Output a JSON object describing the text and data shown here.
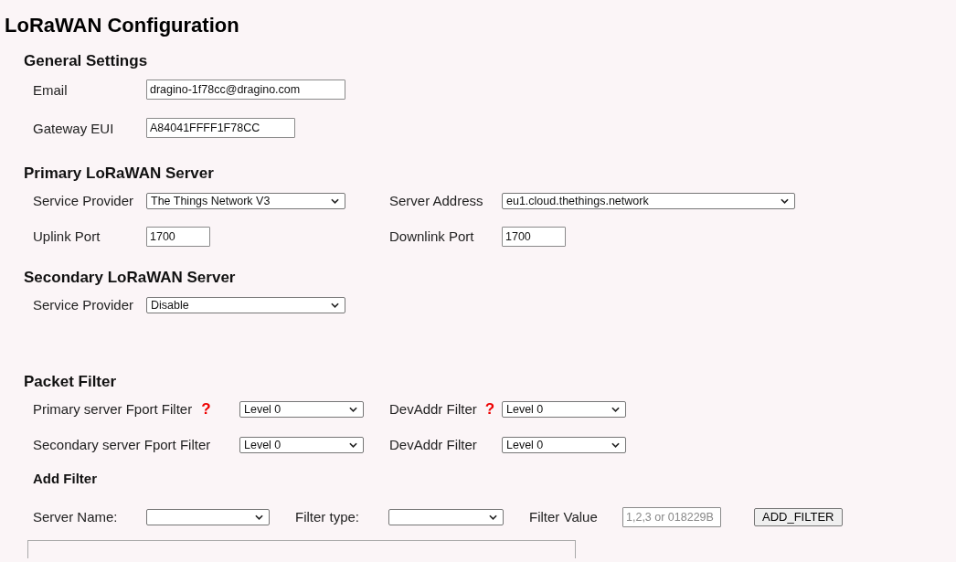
{
  "title": "LoRaWAN Configuration",
  "sections": [
    {
      "heading": "General Settings",
      "rows": [
        [
          {
            "label": "Email",
            "field": {
              "kind": "input",
              "value": "dragino-1f78cc@dragino.com"
            }
          }
        ],
        [
          {
            "label": "Gateway EUI",
            "field": {
              "kind": "input",
              "value": "A84041FFFF1F78CC"
            }
          }
        ]
      ]
    },
    {
      "heading": "Primary LoRaWAN Server",
      "rows": [
        [
          {
            "label": "Service Provider",
            "field": {
              "kind": "select",
              "value": "The Things Network V3"
            }
          },
          {
            "label": "Server Address",
            "field": {
              "kind": "select",
              "value": "eu1.cloud.thethings.network"
            }
          }
        ],
        [
          {
            "label": "Uplink Port",
            "field": {
              "kind": "input",
              "value": "1700"
            }
          },
          {
            "label": "Downlink Port",
            "field": {
              "kind": "input",
              "value": "1700"
            }
          }
        ]
      ]
    },
    {
      "heading": "Secondary LoRaWAN Server",
      "rows": [
        [
          {
            "label": "Service Provider",
            "field": {
              "kind": "select",
              "value": "Disable"
            }
          }
        ]
      ]
    },
    {
      "heading": "Packet Filter",
      "rows": [
        [
          {
            "label": "Primary server Fport Filter",
            "help": "?",
            "field": {
              "kind": "select",
              "value": "Level 0"
            }
          },
          {
            "label": "DevAddr Filter",
            "help": "?",
            "field": {
              "kind": "select",
              "value": "Level 0"
            }
          }
        ],
        [
          {
            "label": "Secondary server Fport Filter",
            "field": {
              "kind": "select",
              "value": "Level 0"
            }
          },
          {
            "label": "DevAddr Filter",
            "field": {
              "kind": "select",
              "value": "Level 0"
            }
          }
        ]
      ],
      "subsection": {
        "heading": "Add Filter",
        "rows": [
          [
            {
              "label": "Server Name:",
              "field": {
                "kind": "select"
              }
            },
            {
              "label": "Filter type:",
              "field": {
                "kind": "select"
              }
            },
            {
              "label": "Filter Value",
              "field": {
                "kind": "input",
                "placeholder": "1,2,3 or 018229B"
              }
            },
            {
              "label": "ADD_FILTER",
              "kind": "button"
            }
          ]
        ]
      }
    }
  ]
}
